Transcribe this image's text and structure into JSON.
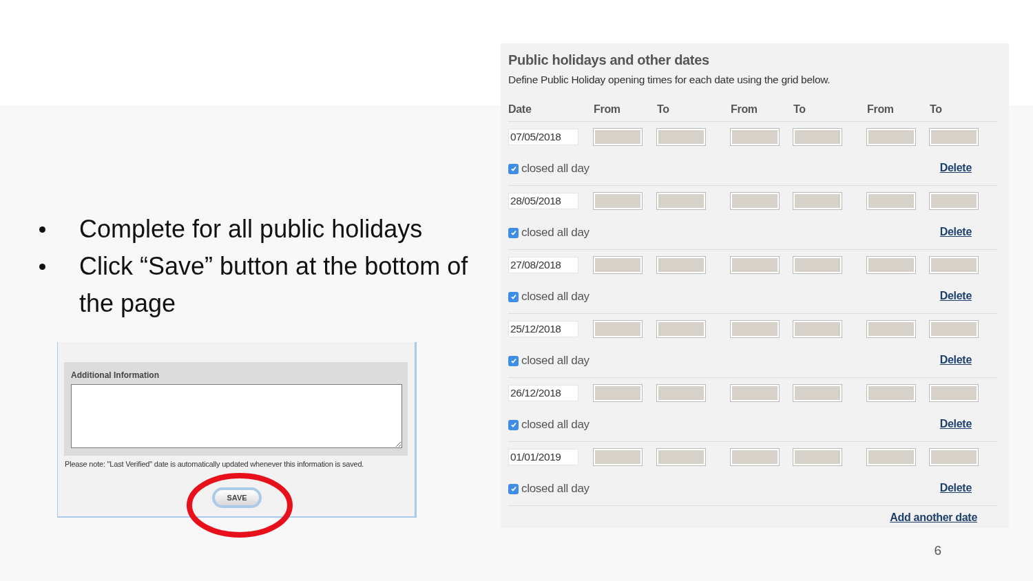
{
  "bullets": [
    "Complete for all public holidays",
    "Click “Save” button at the bottom of the page"
  ],
  "info_form": {
    "label": "Additional Information",
    "note": "Please note: \"Last Verified\" date is automatically updated whenever this information is saved.",
    "save_button": "SAVE"
  },
  "holidays": {
    "title": "Public holidays and other dates",
    "description": "Define Public Holiday opening times for each date using the grid below.",
    "columns": [
      "Date",
      "From",
      "To",
      "From",
      "To",
      "From",
      "To"
    ],
    "rows": [
      {
        "date": "07/05/2018",
        "closed_all_day": true,
        "closed_label": "closed all day",
        "delete": "Delete"
      },
      {
        "date": "28/05/2018",
        "closed_all_day": true,
        "closed_label": "closed all day",
        "delete": "Delete"
      },
      {
        "date": "27/08/2018",
        "closed_all_day": true,
        "closed_label": "closed all day",
        "delete": "Delete"
      },
      {
        "date": "25/12/2018",
        "closed_all_day": true,
        "closed_label": "closed all day",
        "delete": "Delete"
      },
      {
        "date": "26/12/2018",
        "closed_all_day": true,
        "closed_label": "closed all day",
        "delete": "Delete"
      },
      {
        "date": "01/01/2019",
        "closed_all_day": true,
        "closed_label": "closed all day",
        "delete": "Delete"
      }
    ],
    "add_link": "Add another date"
  },
  "page_number": "6"
}
